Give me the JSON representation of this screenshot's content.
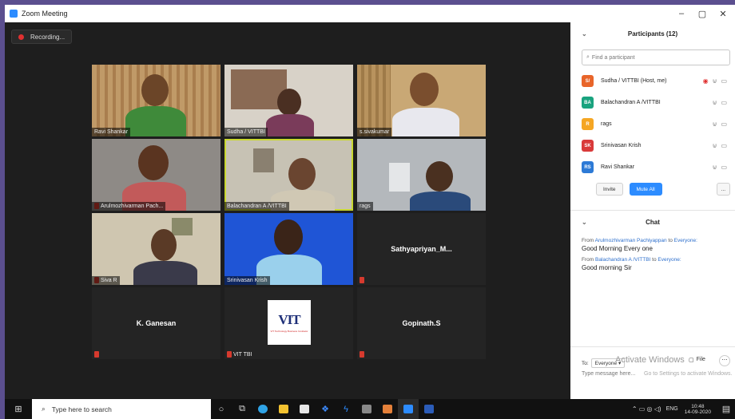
{
  "window": {
    "title": "Zoom Meeting",
    "controls": [
      "–",
      "▢",
      "✕"
    ]
  },
  "recording": {
    "label": "Recording..."
  },
  "tiles": [
    {
      "name": "Ravi Shankar"
    },
    {
      "name": "Sudha / VITTBI"
    },
    {
      "name": "s.sivakumar"
    },
    {
      "name": "Arulmozhivarman Pach..."
    },
    {
      "name": "Balachandran A /VITTBI"
    },
    {
      "name": "rags"
    },
    {
      "name": "Siva R"
    },
    {
      "name": "Srinivasan Krish"
    },
    {
      "name": "Sathyapriyan_M..."
    },
    {
      "name": "K. Ganesan"
    },
    {
      "name": "VIT TBI"
    },
    {
      "name": "Gopinath.S"
    }
  ],
  "vit_logo": {
    "text": "VIT",
    "sub": "VIT Technology Business Incubator"
  },
  "participants_panel": {
    "title": "Participants (12)",
    "search_placeholder": "Find a participant",
    "list": [
      {
        "initials": "S/",
        "name": "Sudha / VITTBI (Host, me)",
        "color": "#e8652a"
      },
      {
        "initials": "BA",
        "name": "Balachandran A /VITTBI",
        "color": "#1aa37f"
      },
      {
        "initials": "R",
        "name": "rags",
        "color": "#f5a623"
      },
      {
        "initials": "SK",
        "name": "Srinivasan Krish",
        "color": "#d93a3a"
      },
      {
        "initials": "RS",
        "name": "Ravi Shankar",
        "color": "#2d7ad6"
      }
    ],
    "invite": "Invite",
    "mute_all": "Mute All",
    "more": "..."
  },
  "chat": {
    "title": "Chat",
    "messages": [
      {
        "from_prefix": "From",
        "from": "Arulmozhivarman Pachiyappan",
        "to_text": "to",
        "to": "Everyone:",
        "text": "Good Morning Every one"
      },
      {
        "from_prefix": "From",
        "from": "Balachandran A /VITTBI",
        "to_text": "to",
        "to": "Everyone:",
        "text": "Good morning Sir"
      }
    ],
    "to_label": "To:",
    "to_value": "Everyone",
    "file_label": "File",
    "input_placeholder": "Type message here...",
    "watermark_title": "Activate Windows",
    "watermark_sub": "Go to Settings to activate Windows."
  },
  "taskbar": {
    "search_placeholder": "Type here to search",
    "lang": "ENG",
    "time": "10:48",
    "date": "14-09-2020"
  }
}
